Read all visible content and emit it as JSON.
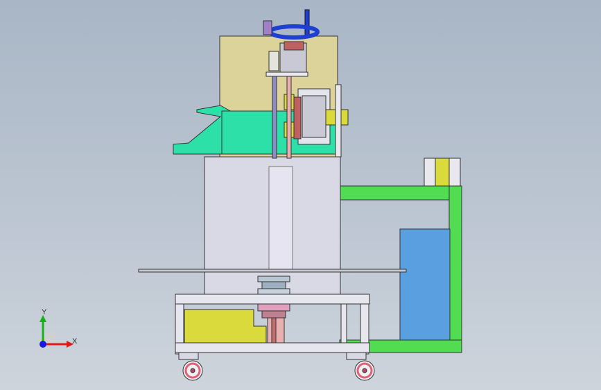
{
  "viewport": {
    "background_top": "#a9b6c5",
    "background_bottom": "#cdd4dc"
  },
  "model": {
    "colors": {
      "upper_housing": "#dcd39a",
      "green_funnel": "#2de0a8",
      "frame_green": "#52dc52",
      "yellow_block": "#dada3c",
      "blue_tank": "#5aa0e0",
      "cabinet": "#d9d9e6",
      "handwheel": "#1f3fd0",
      "wheel_rim": "#e0607a"
    },
    "icons": [
      "handwheel-icon",
      "caster-wheel-icon"
    ]
  },
  "triad": {
    "y_label": "Y",
    "x_label": "X",
    "colors": {
      "y": "#18b018",
      "x": "#e01818",
      "z": "#1818e0"
    }
  }
}
